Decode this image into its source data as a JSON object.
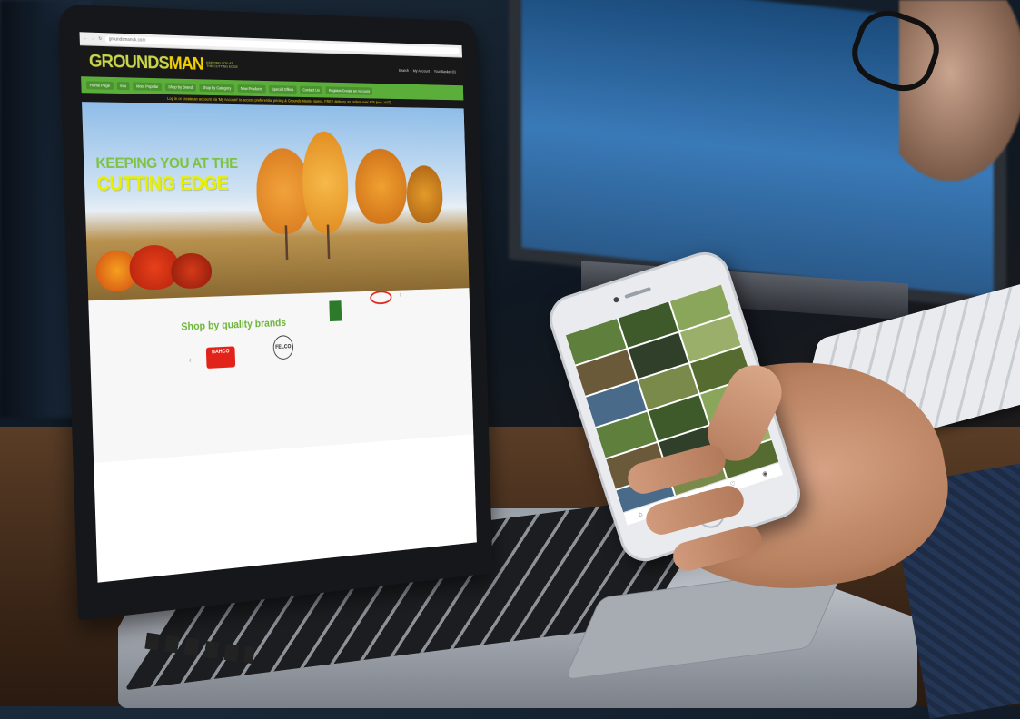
{
  "browser": {
    "url": "groundsmanuk.com"
  },
  "site": {
    "logo_main": "GROUNDS",
    "logo_accent": "MAN",
    "tagline": "KEEPING YOU AT THE CUTTING EDGE",
    "utility": [
      "Search",
      "My Account",
      "Your Basket (0)"
    ],
    "nav": [
      "Home Page",
      "Info",
      "Most Popular",
      "Shop by Brand",
      "Shop by Category",
      "New Products",
      "Special Offers",
      "Contact Us",
      "Register/Create an Account"
    ],
    "login_strip": "Log in or create an account via 'My Account' to access preferential pricing & Grounds Master spend. FREE delivery on orders over £75 (exc. VAT)"
  },
  "hero": {
    "line1": "KEEPING YOU AT THE",
    "line2": "CUTTING EDGE"
  },
  "brands": {
    "title": "Shop by quality brands",
    "items": [
      "BAHCO",
      "FELCO",
      "",
      ""
    ],
    "prev": "‹",
    "next": "›"
  },
  "phone": {
    "tile_count": 18,
    "nav_icons": [
      "home-icon",
      "search-icon",
      "add-icon",
      "heart-icon",
      "profile-icon"
    ]
  }
}
